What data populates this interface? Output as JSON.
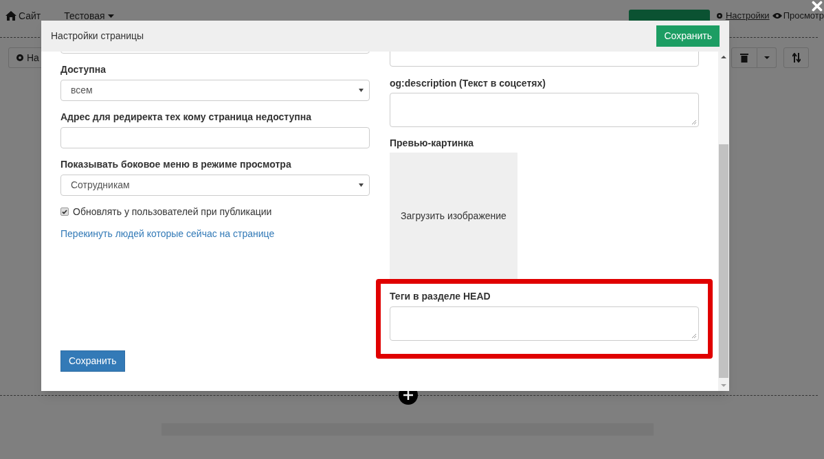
{
  "background": {
    "breadcrumbs": [
      {
        "label": "Сайт"
      },
      {
        "label": "Тестовая"
      }
    ],
    "toolbar_button": "На",
    "links": [
      {
        "label": "Настройки",
        "underlined": true
      },
      {
        "label": "Просмотр",
        "underlined": false
      }
    ]
  },
  "modal": {
    "title": "Настройки страницы",
    "header_button": "Сохранить",
    "left_fields": [
      {
        "kind": "select",
        "label": "Доступна",
        "value": "всем"
      },
      {
        "kind": "input",
        "label": "Адрес для редиректа тех кому страница недоступна"
      },
      {
        "kind": "select",
        "label": "Показывать боковое меню в режиме просмотра",
        "value": "Сотрудникам"
      },
      {
        "kind": "checkbox",
        "label": "Обновлять у пользователей при публикации",
        "checked": true
      },
      {
        "kind": "link",
        "label": "Перекинуть людей которые сейчас на странице"
      }
    ],
    "right_fields": [
      {
        "kind": "textarea",
        "label": "og:description (Текст в соцсетях)",
        "highlighted": false
      },
      {
        "kind": "image",
        "label": "Превью-картинка",
        "button": "Загрузить изображение"
      },
      {
        "kind": "textarea",
        "label": "Теги в разделе HEAD",
        "highlighted": true
      }
    ],
    "footer_button": "Сохранить"
  }
}
